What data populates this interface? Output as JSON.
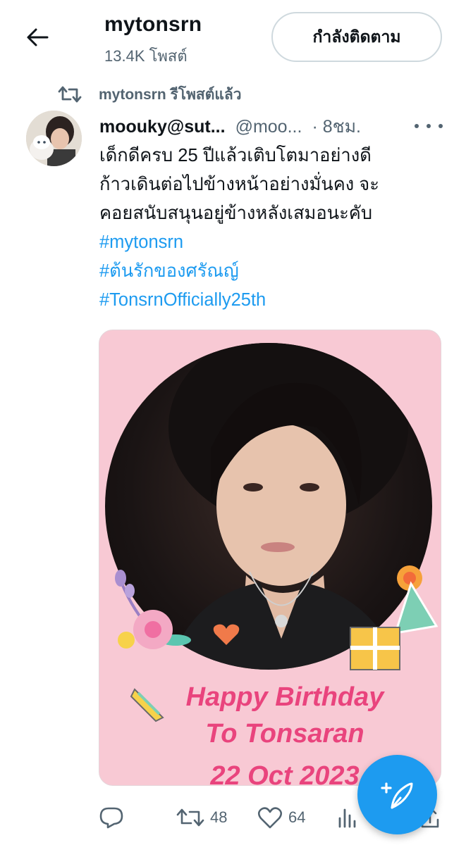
{
  "header": {
    "profile_name": "mytonsrn",
    "post_count": "13.4K โพสต์",
    "follow_label": "กำลังติดตาม"
  },
  "retweet": {
    "label": "mytonsrn รีโพสต์แล้ว"
  },
  "tweet": {
    "display_name": "moouky@sut...",
    "handle": "@moo...",
    "time": "· 8ชม.",
    "text_lines": [
      "เด็กดีครบ 25 ปีแล้วเติบโตมาอย่างดี",
      "ก้าวเดินต่อไปข้างหน้าอย่างมั่นคง จะ",
      "คอยสนับสนุนอยู่ข้างหลังเสมอนะคับ"
    ],
    "hashtags": [
      "#mytonsrn",
      "#ต้นรักของศรัณญ์",
      "#TonsrnOfficially25th"
    ],
    "media": {
      "line1": "Happy Birthday",
      "line2": "To Tonsaran",
      "line3": "22 Oct 2023"
    }
  },
  "actions": {
    "reply_count": "",
    "retweet_count": "48",
    "like_count": "64",
    "views_count": ""
  },
  "colors": {
    "accent": "#1d9bf0",
    "muted": "#536471",
    "media_bg": "#f8c9d4",
    "bday_pink": "#e9447d"
  },
  "icons": [
    "back-arrow-icon",
    "retweet-icon",
    "more-icon",
    "reply-icon",
    "like-icon",
    "views-icon",
    "share-icon",
    "compose-icon"
  ]
}
